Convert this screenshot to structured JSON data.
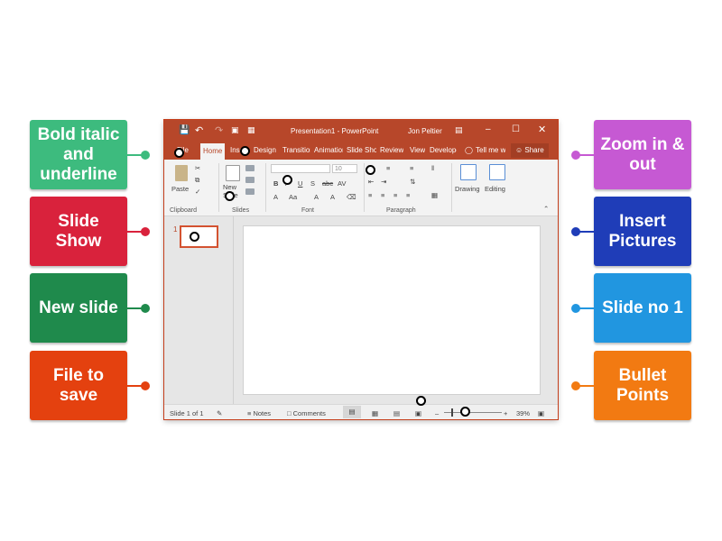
{
  "labels": {
    "bold_italic_underline": "Bold italic and underline",
    "slide_show": "Slide Show",
    "new_slide": "New slide",
    "file_to_save": "File to save",
    "zoom": "Zoom in & out",
    "insert_pictures": "Insert Pictures",
    "slide_no": "Slide no 1",
    "bullet_points": "Bullet Points"
  },
  "colors": {
    "green": "#3dbb7e",
    "red": "#d9223c",
    "dark_green": "#1f8a4c",
    "orange_red": "#e4410f",
    "purple": "#c659d3",
    "navy": "#1f3db8",
    "sky": "#2196e0",
    "orange": "#f27a12",
    "ppt_red": "#b7472a"
  },
  "window": {
    "title": "Presentation1 - PowerPoint",
    "user": "Jon Peltier",
    "tabs": [
      "File",
      "Home",
      "Insert",
      "Design",
      "Transitions",
      "Animations",
      "Slide Show",
      "Review",
      "View",
      "Developer"
    ],
    "tell_me": "Tell me w",
    "share": "Share"
  },
  "ribbon": {
    "paste": "Paste",
    "new_slide": "New Slide",
    "font_size": "10",
    "drawing": "Drawing",
    "editing": "Editing",
    "groups": [
      "Clipboard",
      "Slides",
      "Font",
      "Paragraph"
    ]
  },
  "thumbnail": {
    "number": "1"
  },
  "status": {
    "slide_count": "Slide 1 of 1",
    "notes": "Notes",
    "comments": "Comments",
    "zoom": "39%"
  }
}
